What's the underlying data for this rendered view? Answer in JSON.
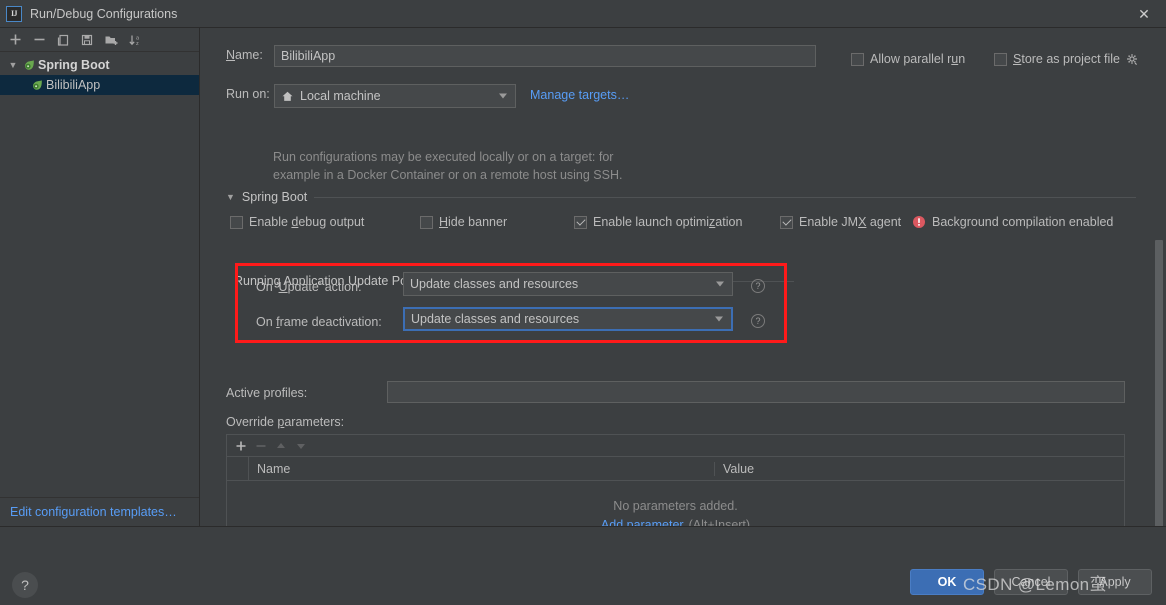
{
  "window": {
    "title": "Run/Debug Configurations",
    "logo_text": "IJ",
    "close_icon": "close-icon"
  },
  "sidebar": {
    "toolbar": [
      {
        "name": "add-configuration-button",
        "icon": "plus-icon"
      },
      {
        "name": "remove-configuration-button",
        "icon": "minus-icon"
      },
      {
        "name": "copy-configuration-button",
        "icon": "copy-icon"
      },
      {
        "name": "save-configuration-button",
        "icon": "save-icon"
      },
      {
        "name": "new-folder-button",
        "icon": "folder-add-icon"
      },
      {
        "name": "sort-configurations-button",
        "icon": "sort-az-icon"
      }
    ],
    "tree": {
      "group_label": "Spring Boot",
      "child_label": "BilibiliApp"
    },
    "edit_templates_link": "Edit configuration templates…"
  },
  "form": {
    "name_label": "Name:",
    "name_label_mnemonic": "N",
    "name_value": "BilibiliApp",
    "allow_parallel_run_label": "Allow parallel run",
    "allow_parallel_run_checked": false,
    "store_as_project_file_label": "Store as project file",
    "store_as_project_file_checked": false,
    "store_gear_icon": "gear-icon",
    "run_on_label": "Run on:",
    "run_on_value": "Local machine",
    "run_on_icon": "home-icon",
    "manage_targets_link": "Manage targets…",
    "hint_line_1": "Run configurations may be executed locally or on a target: for",
    "hint_line_2": "example in a Docker Container or on a remote host using SSH."
  },
  "spring_boot": {
    "section_title": "Spring Boot",
    "collapse_icon": "triangle-down-icon",
    "checkboxes": [
      {
        "label": "Enable debug output",
        "checked": false,
        "name": "enable-debug-output-checkbox"
      },
      {
        "label": "Hide banner",
        "checked": false,
        "name": "hide-banner-checkbox"
      },
      {
        "label": "Enable launch optimization",
        "checked": true,
        "name": "enable-launch-optimization-checkbox"
      },
      {
        "label": "Enable JMX agent",
        "checked": true,
        "name": "enable-jmx-agent-checkbox"
      }
    ],
    "warning_icon": "error-circle-icon",
    "warning_text": "Background compilation enabled",
    "warning_color": "#db5860"
  },
  "update_policies": {
    "section_title": "Running Application Update Policies",
    "highlight_color": "#ff1a1a",
    "rows": [
      {
        "label": "On 'Update' action:",
        "value": "Update classes and resources",
        "focused": false,
        "help_icon": "help-circle-icon"
      },
      {
        "label": "On frame deactivation:",
        "value": "Update classes and resources",
        "focused": true,
        "help_icon": "help-circle-icon"
      }
    ]
  },
  "profiles": {
    "active_profiles_label": "Active profiles:",
    "active_profiles_value": "",
    "override_parameters_label": "Override parameters:",
    "table_toolbar": [
      {
        "name": "add-parameter-button",
        "icon": "plus-icon",
        "enabled": true
      },
      {
        "name": "remove-parameter-button",
        "icon": "minus-icon",
        "enabled": false
      },
      {
        "name": "move-up-button",
        "icon": "triangle-up-icon",
        "enabled": false
      },
      {
        "name": "move-down-button",
        "icon": "triangle-down-icon",
        "enabled": false
      }
    ],
    "columns": [
      "Name",
      "Value"
    ],
    "empty_text": "No parameters added.",
    "empty_link": "Add parameter",
    "empty_shortcut": "(Alt+Insert)"
  },
  "footer": {
    "help_icon": "question-mark-icon",
    "ok_label": "OK",
    "cancel_label": "Cancel",
    "apply_label": "Apply"
  },
  "watermark": "CSDN @Lemon蛮"
}
